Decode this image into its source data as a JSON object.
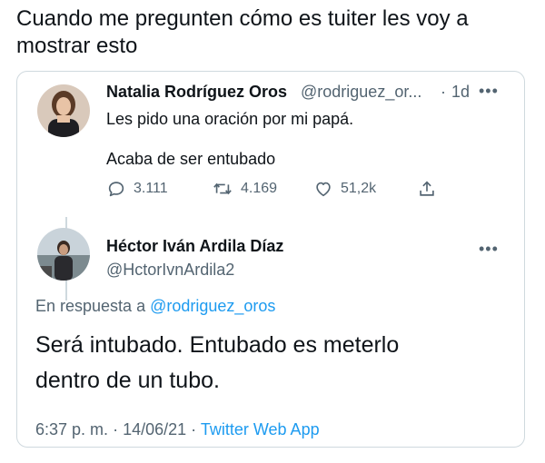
{
  "caption": {
    "line1": "Cuando me pregunten cómo es tuiter les voy a",
    "line2": "mostrar esto"
  },
  "parent_tweet": {
    "author_name": "Natalia Rodríguez Oros",
    "author_handle": "@rodriguez_or...",
    "separator": "·",
    "time": "1d",
    "text_line1": "Les pido una oración por mi papá.",
    "text_line2": "Acaba de ser entubado",
    "reply_count": "3.111",
    "retweet_count": "4.169",
    "like_count": "51,2k",
    "icons": [
      "reply-icon",
      "retweet-icon",
      "like-icon",
      "share-icon"
    ]
  },
  "reply_tweet": {
    "author_name": "Héctor Iván Ardila Díaz",
    "author_handle": "@HctorIvnArdila2",
    "replying_prefix": "En respuesta a",
    "replying_to": "@rodriguez_oros",
    "text_line1": "Será intubado. Entubado es meterlo",
    "text_line2": "dentro de un tubo.",
    "time": "6:37 p. m.",
    "sep1": "·",
    "date": "14/06/21",
    "sep2": "·",
    "source": "Twitter Web App"
  },
  "colors": {
    "text": "#0f1419",
    "secondary": "#536471",
    "link": "#1d9bf0",
    "border": "#cfd9de"
  }
}
